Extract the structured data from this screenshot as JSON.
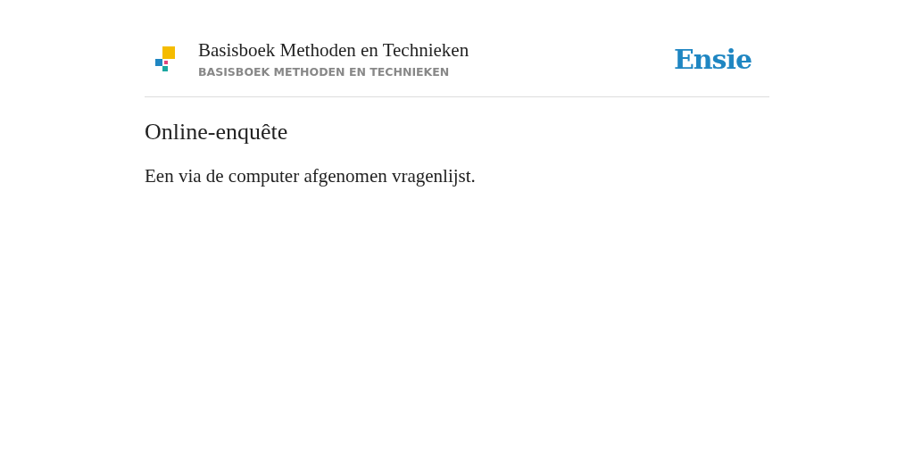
{
  "header": {
    "title": "Basisboek Methoden en Technieken",
    "subtitle": "BASISBOEK METHODEN EN TECHNIEKEN",
    "brand": "Ensie"
  },
  "entry": {
    "title": "Online-enquête",
    "definition": "Een via de computer afgenomen vragenlijst."
  }
}
